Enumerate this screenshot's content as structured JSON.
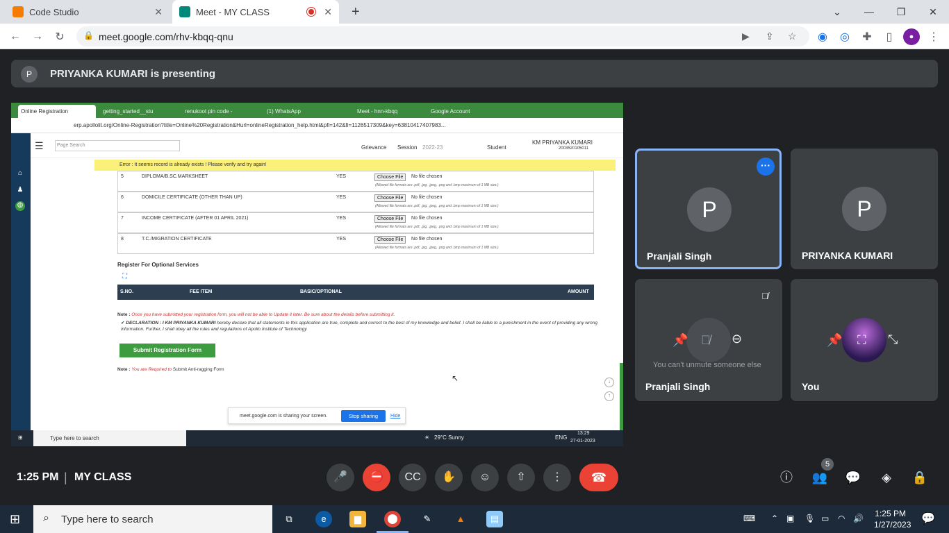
{
  "browser": {
    "tabs": [
      {
        "label": "Code Studio",
        "favicon_color": "#f57c00"
      },
      {
        "label": "Meet - MY CLASS",
        "favicon_color": "#00897b"
      }
    ],
    "new_tab": "+",
    "url": "meet.google.com/rhv-kbqq-qnu"
  },
  "presenter": {
    "initial": "P",
    "text": "PRIYANKA KUMARI is presenting"
  },
  "shared": {
    "tabs": [
      "Online Registration",
      "getting_started__stu",
      "renukoot pin code -",
      "(1) WhatsApp",
      "Meet - hnn-kbqq",
      "Google Account"
    ],
    "url": "erp.apollolit.org/Online-Registration?title=Online%20Registration&Hurl=onlineRegistration_help.html&pfi=142&fi=1126517309&key=63810417407983...",
    "search_placeholder": "Page Search",
    "grievance": "Grievance",
    "session_label": "Session",
    "session_value": "2022-23",
    "student": "Student",
    "user_name": "KM PRIYANKA KUMARI",
    "user_id": "2003520105011",
    "error": "Error : It seems record is already exists ! Please verify and try again!",
    "rows": [
      {
        "sno": "5",
        "name": "DIPLOMA/B.SC.MARKSHEET",
        "req": "YES"
      },
      {
        "sno": "6",
        "name": "DOMICILE CERTIFICATE (OTHER THAN UP)",
        "req": "YES"
      },
      {
        "sno": "7",
        "name": "INCOME CERTIFICATE (AFTER 01 APRIL 2021)",
        "req": "YES"
      },
      {
        "sno": "8",
        "name": "T.C./MIGRATION CERTIFICATE",
        "req": "YES"
      }
    ],
    "choose_file": "Choose File",
    "no_file": "No file chosen",
    "allowed": "(Allowed file formats are .pdf, .jpg, .jpeg, .png and .bmp maximum of 1 MB size.)",
    "optional_title": "Register For Optional Services",
    "table_headers": {
      "sno": "S.NO.",
      "fee": "FEE ITEM",
      "basic": "BASIC/OPTIONAL",
      "amount": "AMOUNT"
    },
    "note_label": "Note :",
    "note_text": "Once you have submitted your registration form, you will not be able to Update it later. Be sure about the details before submitting it.",
    "declaration_label": "DECLARATION : I KM PRIYANKA KUMARI",
    "declaration": "hereby declare that all statements in this application are true, complete and correct to the best of my knowledge and belief. I shall be liable to a punishment in the event of providing any wrong information. Further, I shall obey all the rules and regulations of Apollo Institute of Technology",
    "submit": "Submit Registration Form",
    "note2_red": "You are Required to",
    "note2_link": "Submit Anti-ragging Form",
    "sharing_text": "meet.google.com is sharing your screen.",
    "stop_sharing": "Stop sharing",
    "hide": "Hide",
    "task_search": "Type here to search",
    "weather": "29°C  Sunny",
    "lang": "ENG",
    "time": "13:29",
    "date": "27-01-2023"
  },
  "participants": [
    {
      "initial": "P",
      "name": "Pranjali Singh"
    },
    {
      "initial": "P",
      "name": "PRIYANKA KUMARI"
    },
    {
      "name": "Pranjali Singh",
      "hint": "You can't unmute someone else"
    },
    {
      "name": "You"
    }
  ],
  "controls": {
    "time": "1:25 PM",
    "separator": "|",
    "meeting": "MY CLASS",
    "people_count": "5"
  },
  "taskbar": {
    "search": "Type here to search",
    "time": "1:25 PM",
    "date": "1/27/2023"
  }
}
